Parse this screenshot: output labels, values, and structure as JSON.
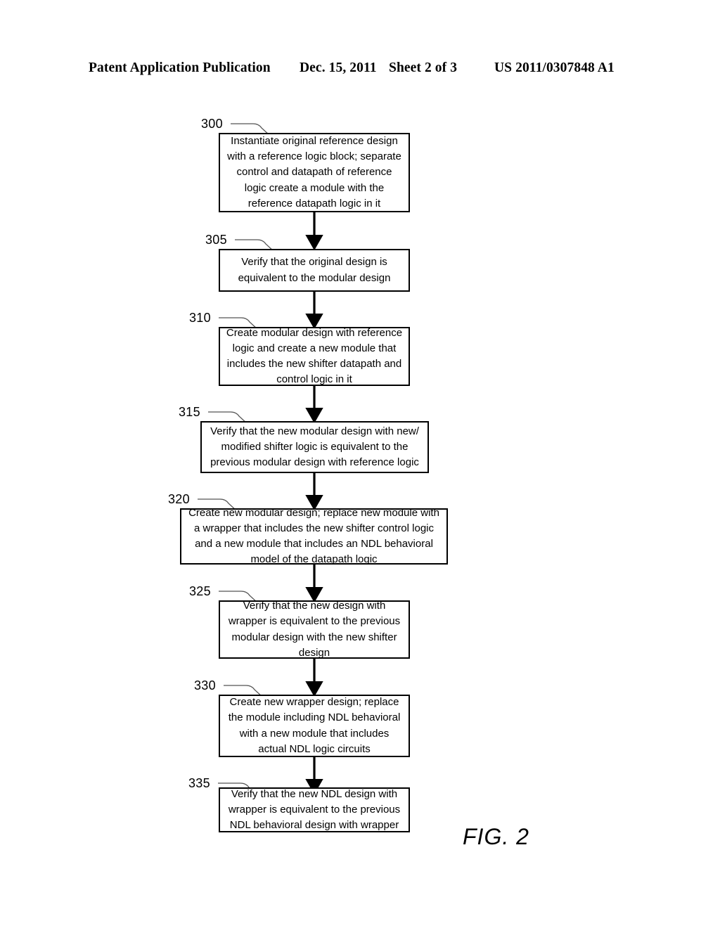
{
  "header": {
    "publication": "Patent Application Publication",
    "date": "Dec. 15, 2011",
    "sheet": "Sheet 2 of 3",
    "patent_number": "US 2011/0307848 A1"
  },
  "figure": {
    "caption": "FIG. 2",
    "type": "flowchart",
    "steps": [
      {
        "ref": "300",
        "text": "Instantiate original reference design with a reference logic block; separate control and datapath of reference logic create a module with the reference datapath logic in it"
      },
      {
        "ref": "305",
        "text": "Verify that the original design is equivalent to the modular design"
      },
      {
        "ref": "310",
        "text": "Create modular design with reference logic and create a new module that includes the new shifter datapath and control logic in it"
      },
      {
        "ref": "315",
        "text": "Verify that the new modular design with new/ modified shifter logic is equivalent to the previous modular design with reference logic"
      },
      {
        "ref": "320",
        "text": "Create new modular design; replace new module with a wrapper that includes the new shifter control logic and a new module that includes an NDL behavioral model of the datapath logic"
      },
      {
        "ref": "325",
        "text": "Verify that the new design with wrapper is equivalent to the previous modular design with the new shifter design"
      },
      {
        "ref": "330",
        "text": "Create new wrapper design; replace the module including NDL behavioral with a new module that includes actual NDL logic circuits"
      },
      {
        "ref": "335",
        "text": "Verify that the new NDL design with wrapper is equivalent to the previous NDL behavioral design with wrapper"
      }
    ]
  }
}
